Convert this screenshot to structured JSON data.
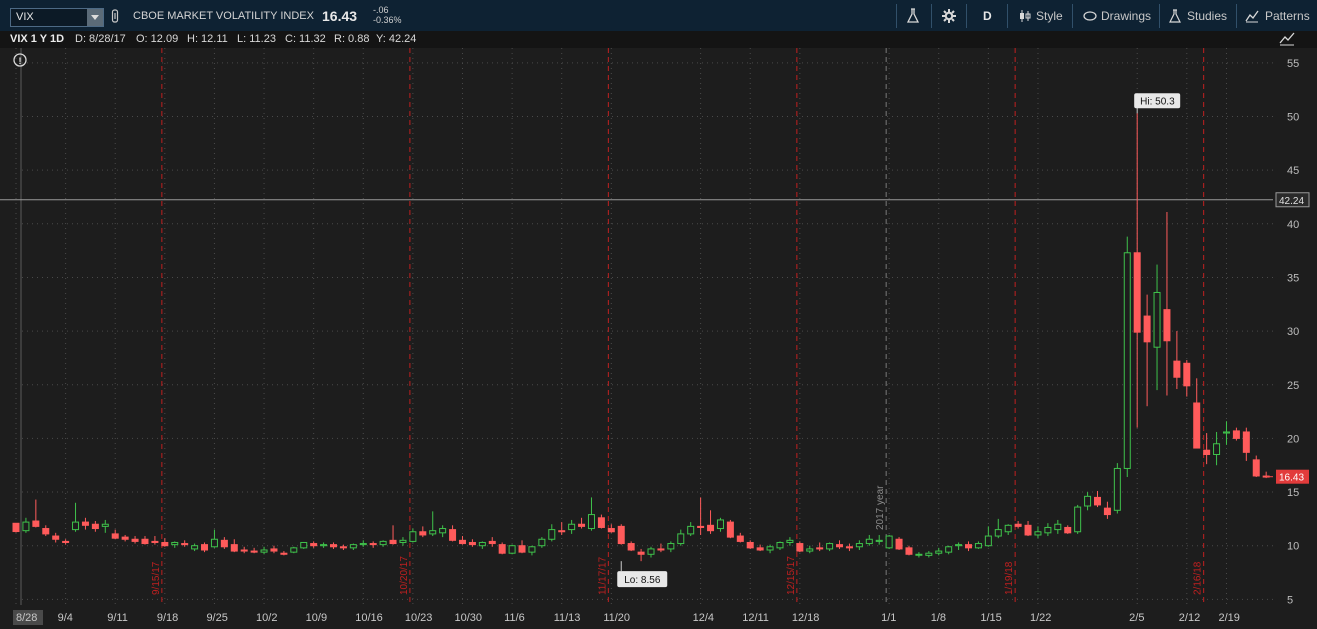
{
  "header": {
    "symbol": "VIX",
    "name": "CBOE MARKET VOLATILITY INDEX",
    "last": "16.43",
    "change": "-.06",
    "change_pct": "-0.36%",
    "period": "D",
    "style_label": "Style",
    "drawings_label": "Drawings",
    "studies_label": "Studies",
    "patterns_label": "Patterns"
  },
  "info": {
    "title": "VIX 1 Y 1D",
    "date": "D: 8/28/17",
    "open": "O: 12.09",
    "high": "H: 12.11",
    "low": "L: 11.23",
    "close": "C: 11.32",
    "range": "R: 0.88",
    "y": "Y: 42.24"
  },
  "colors": {
    "up": "#3fc24b",
    "down": "#ff5b5b",
    "accent": "#1f5e8a"
  },
  "chart_data": {
    "type": "candlestick",
    "ylim": [
      4,
      56
    ],
    "yticks": [
      5,
      10,
      15,
      20,
      25,
      30,
      35,
      40,
      45,
      50,
      55
    ],
    "x_labels": [
      {
        "i": 0,
        "t": "8/28"
      },
      {
        "i": 5,
        "t": "9/4"
      },
      {
        "i": 10,
        "t": "9/11"
      },
      {
        "i": 15,
        "t": "9/18"
      },
      {
        "i": 20,
        "t": "9/25"
      },
      {
        "i": 25,
        "t": "10/2"
      },
      {
        "i": 30,
        "t": "10/9"
      },
      {
        "i": 35,
        "t": "10/16"
      },
      {
        "i": 40,
        "t": "10/23"
      },
      {
        "i": 45,
        "t": "10/30"
      },
      {
        "i": 50,
        "t": "11/6"
      },
      {
        "i": 55,
        "t": "11/13"
      },
      {
        "i": 60,
        "t": "11/20"
      },
      {
        "i": 69,
        "t": "12/4"
      },
      {
        "i": 74,
        "t": "12/11"
      },
      {
        "i": 79,
        "t": "12/18"
      },
      {
        "i": 88,
        "t": "1/1"
      },
      {
        "i": 93,
        "t": "1/8"
      },
      {
        "i": 98,
        "t": "1/15"
      },
      {
        "i": 103,
        "t": "1/22"
      },
      {
        "i": 113,
        "t": "2/5"
      },
      {
        "i": 118,
        "t": "2/12"
      },
      {
        "i": 122,
        "t": "2/19"
      }
    ],
    "expiration_lines": [
      {
        "i": 14.7,
        "t": "9/15/17"
      },
      {
        "i": 39.7,
        "t": "10/20/17"
      },
      {
        "i": 59.7,
        "t": "11/17/17"
      },
      {
        "i": 78.7,
        "t": "12/15/17"
      },
      {
        "i": 100.7,
        "t": "1/19/18"
      },
      {
        "i": 119.7,
        "t": "2/16/18"
      }
    ],
    "year_line": {
      "i": 87.7,
      "t": "2017 year"
    },
    "horizontal_line": 42.24,
    "last_price": 16.43,
    "hi": {
      "i": 113,
      "v": 50.3,
      "label": "Hi: 50.3"
    },
    "lo": {
      "i": 61,
      "v": 8.56,
      "label": "Lo: 8.56"
    },
    "candles": [
      [
        12.09,
        12.11,
        11.23,
        11.32
      ],
      [
        11.4,
        12.6,
        11.2,
        12.2
      ],
      [
        12.3,
        14.3,
        11.7,
        11.8
      ],
      [
        11.6,
        11.9,
        10.9,
        11.1
      ],
      [
        10.9,
        11.2,
        10.3,
        10.6
      ],
      [
        10.4,
        10.6,
        10.1,
        10.3
      ],
      [
        11.5,
        14.0,
        11.3,
        12.2
      ],
      [
        12.2,
        12.6,
        11.5,
        11.9
      ],
      [
        12.0,
        12.3,
        11.3,
        11.6
      ],
      [
        11.8,
        12.4,
        11.2,
        12.0
      ],
      [
        11.1,
        11.5,
        10.6,
        10.7
      ],
      [
        10.8,
        11.0,
        10.4,
        10.6
      ],
      [
        10.6,
        10.9,
        10.2,
        10.4
      ],
      [
        10.6,
        10.9,
        10.1,
        10.2
      ],
      [
        10.4,
        10.9,
        10.1,
        10.3
      ],
      [
        10.3,
        10.7,
        9.9,
        10.0
      ],
      [
        10.1,
        10.4,
        9.8,
        10.3
      ],
      [
        10.2,
        10.5,
        9.9,
        10.1
      ],
      [
        9.7,
        10.2,
        9.5,
        10.0
      ],
      [
        10.1,
        10.3,
        9.4,
        9.6
      ],
      [
        9.9,
        11.5,
        9.8,
        10.6
      ],
      [
        10.5,
        10.8,
        9.7,
        9.9
      ],
      [
        10.1,
        10.6,
        9.4,
        9.5
      ],
      [
        9.6,
        9.9,
        9.3,
        9.5
      ],
      [
        9.5,
        9.8,
        9.3,
        9.4
      ],
      [
        9.4,
        9.9,
        9.2,
        9.6
      ],
      [
        9.7,
        10.0,
        9.3,
        9.5
      ],
      [
        9.3,
        9.5,
        9.1,
        9.2
      ],
      [
        9.4,
        9.9,
        9.3,
        9.8
      ],
      [
        9.8,
        10.3,
        9.7,
        10.3
      ],
      [
        10.2,
        10.4,
        9.8,
        10.0
      ],
      [
        10.0,
        10.3,
        9.8,
        10.1
      ],
      [
        10.1,
        10.3,
        9.7,
        9.9
      ],
      [
        9.9,
        10.1,
        9.6,
        9.8
      ],
      [
        9.8,
        10.2,
        9.6,
        10.1
      ],
      [
        10.1,
        10.5,
        9.9,
        10.2
      ],
      [
        10.2,
        10.4,
        9.8,
        10.1
      ],
      [
        10.1,
        10.5,
        9.9,
        10.4
      ],
      [
        10.5,
        11.9,
        10.1,
        10.2
      ],
      [
        10.3,
        10.8,
        10.0,
        10.5
      ],
      [
        10.4,
        11.6,
        10.3,
        11.3
      ],
      [
        11.3,
        11.8,
        10.8,
        11.0
      ],
      [
        11.1,
        13.2,
        10.9,
        11.4
      ],
      [
        11.2,
        11.9,
        10.8,
        11.6
      ],
      [
        11.5,
        11.9,
        10.4,
        10.5
      ],
      [
        10.5,
        10.9,
        10.1,
        10.2
      ],
      [
        10.3,
        10.6,
        9.9,
        10.1
      ],
      [
        10.0,
        10.4,
        9.7,
        10.3
      ],
      [
        10.4,
        10.8,
        9.9,
        10.2
      ],
      [
        10.1,
        10.3,
        9.2,
        9.3
      ],
      [
        9.3,
        10.1,
        9.2,
        10.0
      ],
      [
        10.0,
        10.5,
        9.3,
        9.4
      ],
      [
        9.4,
        10.0,
        9.1,
        9.9
      ],
      [
        10.0,
        10.8,
        9.8,
        10.6
      ],
      [
        10.6,
        12.0,
        10.4,
        11.5
      ],
      [
        11.4,
        12.2,
        11.0,
        11.3
      ],
      [
        11.5,
        12.4,
        11.1,
        12.0
      ],
      [
        12.0,
        12.6,
        11.6,
        11.8
      ],
      [
        11.6,
        14.5,
        11.4,
        12.9
      ],
      [
        12.6,
        12.9,
        11.6,
        11.7
      ],
      [
        11.6,
        12.0,
        11.2,
        11.3
      ],
      [
        11.8,
        12.0,
        10.1,
        10.2
      ],
      [
        10.2,
        10.4,
        9.5,
        9.6
      ],
      [
        9.4,
        9.7,
        8.56,
        9.2
      ],
      [
        9.2,
        9.9,
        8.9,
        9.7
      ],
      [
        9.7,
        10.2,
        9.4,
        9.6
      ],
      [
        9.7,
        10.4,
        9.4,
        10.2
      ],
      [
        10.2,
        11.5,
        10.0,
        11.1
      ],
      [
        11.1,
        12.2,
        10.9,
        11.8
      ],
      [
        11.8,
        14.5,
        11.0,
        11.7
      ],
      [
        11.9,
        13.3,
        11.1,
        11.4
      ],
      [
        11.6,
        12.6,
        11.3,
        12.4
      ],
      [
        12.2,
        12.4,
        10.7,
        10.8
      ],
      [
        10.9,
        11.2,
        10.3,
        10.4
      ],
      [
        10.3,
        10.5,
        9.7,
        9.8
      ],
      [
        9.8,
        10.1,
        9.5,
        9.6
      ],
      [
        9.6,
        10.1,
        9.3,
        9.9
      ],
      [
        9.8,
        10.4,
        9.6,
        10.3
      ],
      [
        10.3,
        10.8,
        10.0,
        10.5
      ],
      [
        10.2,
        10.4,
        9.4,
        9.5
      ],
      [
        9.5,
        10.0,
        9.3,
        9.7
      ],
      [
        9.8,
        10.3,
        9.5,
        9.7
      ],
      [
        9.7,
        10.3,
        9.5,
        10.2
      ],
      [
        10.1,
        10.5,
        9.7,
        9.9
      ],
      [
        9.9,
        10.2,
        9.5,
        9.8
      ],
      [
        9.9,
        10.5,
        9.6,
        10.2
      ],
      [
        10.2,
        11.0,
        10.0,
        10.6
      ],
      [
        10.4,
        11.0,
        10.1,
        10.5
      ],
      [
        9.8,
        11.0,
        9.7,
        10.9
      ],
      [
        10.6,
        10.8,
        9.6,
        9.7
      ],
      [
        9.8,
        10.0,
        9.1,
        9.2
      ],
      [
        9.2,
        9.4,
        8.9,
        9.2
      ],
      [
        9.1,
        9.5,
        8.9,
        9.3
      ],
      [
        9.3,
        9.8,
        9.1,
        9.5
      ],
      [
        9.4,
        10.0,
        9.2,
        9.9
      ],
      [
        10.0,
        10.3,
        9.6,
        10.1
      ],
      [
        10.1,
        10.4,
        9.5,
        9.8
      ],
      [
        9.8,
        10.4,
        9.7,
        10.2
      ],
      [
        10.0,
        11.8,
        9.9,
        10.9
      ],
      [
        10.9,
        12.5,
        10.7,
        11.5
      ],
      [
        11.3,
        12.0,
        11.0,
        11.9
      ],
      [
        12.0,
        12.3,
        11.6,
        11.8
      ],
      [
        11.9,
        12.3,
        10.9,
        11.0
      ],
      [
        11.0,
        11.8,
        10.7,
        11.3
      ],
      [
        11.2,
        12.1,
        10.9,
        11.7
      ],
      [
        11.5,
        12.4,
        11.1,
        12.0
      ],
      [
        11.7,
        11.9,
        11.1,
        11.2
      ],
      [
        11.3,
        13.8,
        11.1,
        13.6
      ],
      [
        13.7,
        15.0,
        13.3,
        14.6
      ],
      [
        14.5,
        15.1,
        13.6,
        13.8
      ],
      [
        13.5,
        14.1,
        12.5,
        12.9
      ],
      [
        13.3,
        17.7,
        13.0,
        17.2
      ],
      [
        17.2,
        38.8,
        16.4,
        37.3
      ],
      [
        37.3,
        50.3,
        21.0,
        29.9
      ],
      [
        31.4,
        33.4,
        23.0,
        29.0
      ],
      [
        28.5,
        36.2,
        24.5,
        33.6
      ],
      [
        32.0,
        41.1,
        24.0,
        29.1
      ],
      [
        27.2,
        30.0,
        24.6,
        25.7
      ],
      [
        27.0,
        27.3,
        23.9,
        24.9
      ],
      [
        23.3,
        25.6,
        19.1,
        19.1
      ],
      [
        18.9,
        20.5,
        17.6,
        18.5
      ],
      [
        18.5,
        20.6,
        17.5,
        19.5
      ],
      [
        20.5,
        21.6,
        19.4,
        20.6
      ],
      [
        20.7,
        21.0,
        19.8,
        20.0
      ],
      [
        20.6,
        21.0,
        17.9,
        18.7
      ],
      [
        18.0,
        18.4,
        16.4,
        16.5
      ],
      [
        16.49,
        16.9,
        16.3,
        16.43
      ]
    ]
  }
}
